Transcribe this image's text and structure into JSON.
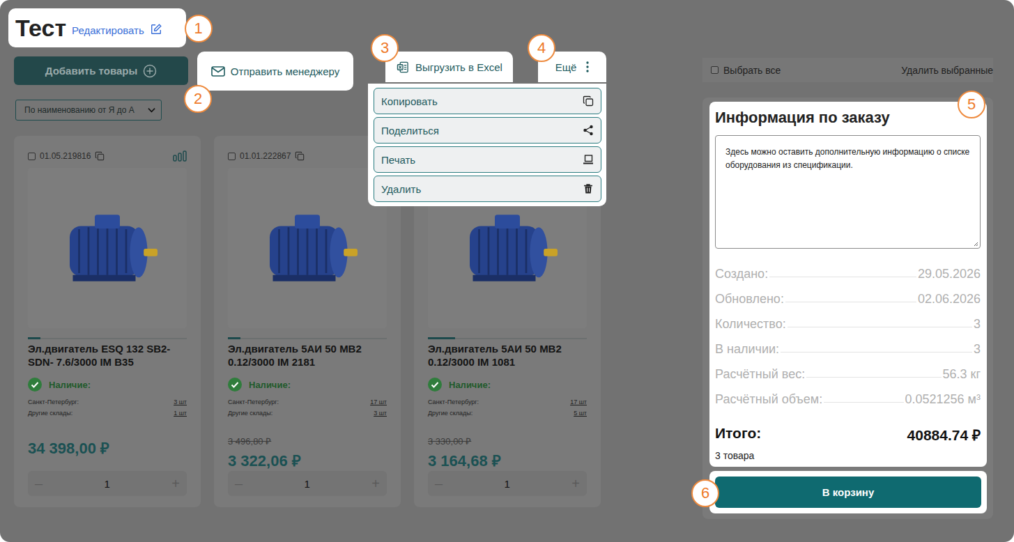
{
  "page": {
    "title": "Тест",
    "edit_link": "Редактировать",
    "step": "1"
  },
  "toolbar": {
    "add_button": "Добавить товары",
    "send_button": {
      "label": "Отправить менеджеру",
      "step": "2"
    },
    "excel_button": {
      "label": "Выгрузить в Excel",
      "step": "3"
    },
    "more_button": {
      "label": "Ещё",
      "step": "4",
      "expanded": true
    }
  },
  "more_menu": [
    {
      "label": "Копировать"
    },
    {
      "label": "Поделиться"
    },
    {
      "label": "Печать"
    },
    {
      "label": "Удалить"
    }
  ],
  "sort": {
    "label": "По наименованию от Я до А"
  },
  "selection": {
    "select_all": "Выбрать все",
    "checked": false,
    "delete_selected": "Удалить выбранные"
  },
  "products": [
    {
      "code": "01.05.219816",
      "checked": false,
      "compare": true,
      "slide_level": 0.08,
      "name": "Эл.двигатель ESQ 132 SB2-SDN- 7.6/3000 IM B35",
      "availability": "Наличие:",
      "stocks": [
        {
          "place": "Санкт-Петербург:",
          "qty": "3 шт"
        },
        {
          "place": "Другие склады:",
          "qty": "1 шт"
        }
      ],
      "price": "34 398,00 ₽",
      "quantity": "1",
      "minus": "–",
      "plus": "+"
    },
    {
      "code": "01.01.222867",
      "checked": false,
      "compare": false,
      "slide_level": 0.08,
      "name": "Эл.двигатель 5АИ 50 MB2 0.12/3000 IM 2181",
      "availability": "Наличие:",
      "stocks": [
        {
          "place": "Санкт-Петербург:",
          "qty": "17 шт"
        },
        {
          "place": "Другие склады:",
          "qty": "3 шт"
        }
      ],
      "old_price": "3 496,80 ₽",
      "price": "3 322,06 ₽",
      "quantity": "1",
      "minus": "–",
      "plus": "+"
    },
    {
      "compare": false,
      "slide_level": 0.17,
      "name": "Эл.двигатель 5АИ 50 MB2 0.12/3000 IM 1081",
      "availability": "Наличие:",
      "stocks": [
        {
          "place": "Санкт-Петербург:",
          "qty": "17 шт"
        },
        {
          "place": "Другие склады:",
          "qty": "5 шт"
        }
      ],
      "old_price": "3 330,00 ₽",
      "price": "3 164,68 ₽",
      "quantity": "1",
      "minus": "–",
      "plus": "+"
    }
  ],
  "order_info": {
    "title": "Информация по заказу",
    "step": "5",
    "comment": "Здесь можно оставить дополнительную информацию о списке оборудования из спецификации.",
    "rows": [
      {
        "label": "Создано:",
        "value": "29.05.2026"
      },
      {
        "label": "Обновлено:",
        "value": "02.06.2026"
      },
      {
        "label": "Количество:",
        "value": "3"
      },
      {
        "label": "В наличии:",
        "value": "3"
      },
      {
        "label": "Расчётный вес:",
        "value": "56.3 кг"
      },
      {
        "label": "Расчётный объем:",
        "value": "0.0521256 м³"
      }
    ],
    "total_label": "Итого:",
    "total_value": "40884.74 ₽",
    "items_count": "3 товара"
  },
  "cart_button": {
    "label": "В корзину",
    "step": "6"
  }
}
